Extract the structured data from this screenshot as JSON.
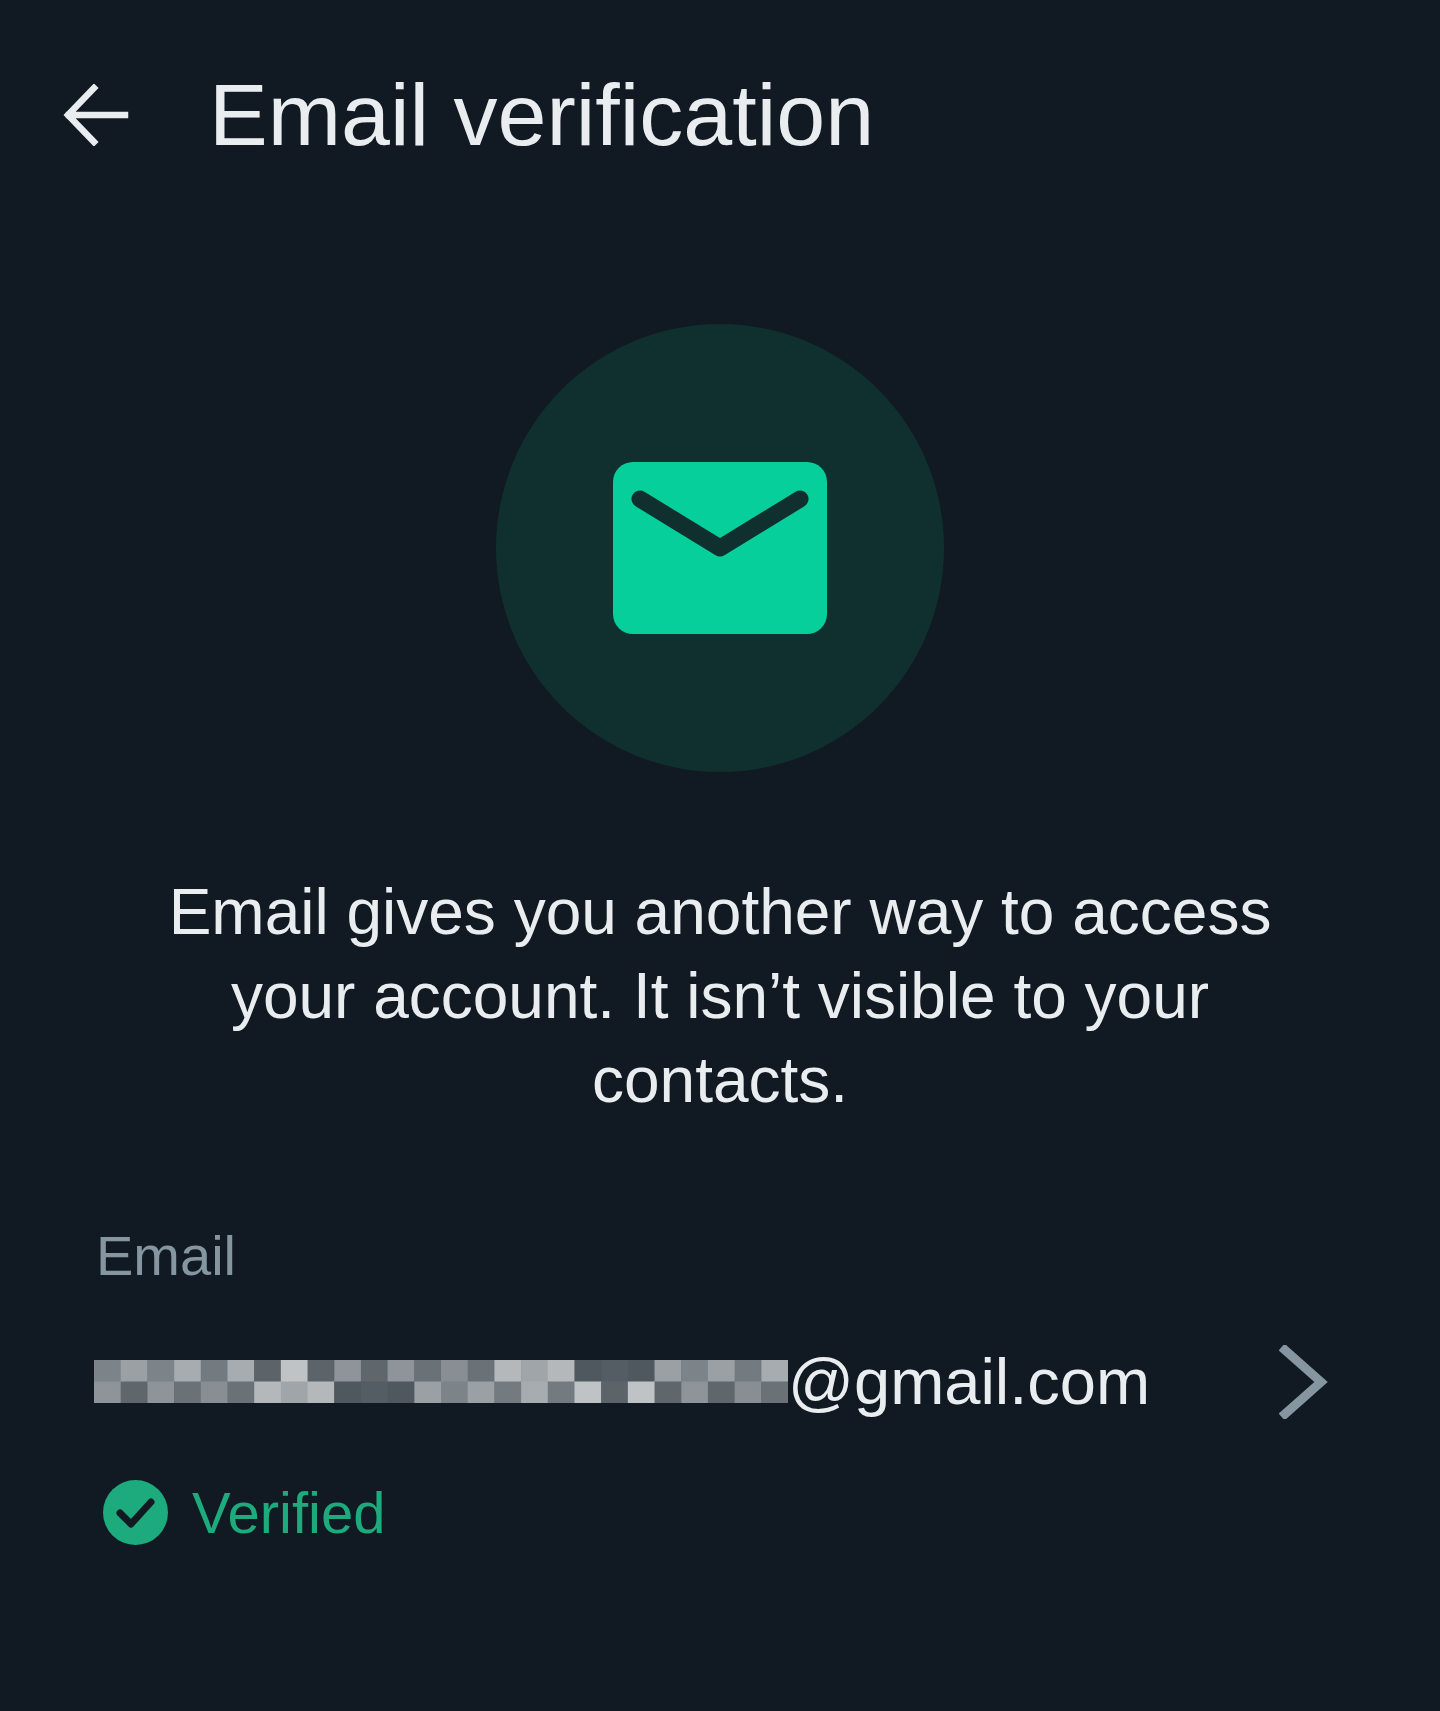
{
  "header": {
    "title": "Email verification"
  },
  "hero": {
    "description": "Email gives you another way to access your account. It isn’t visible to your contacts."
  },
  "email_section": {
    "label": "Email",
    "value": "@gmail.com",
    "redacted": true,
    "verified": true,
    "status": "Verified"
  }
}
